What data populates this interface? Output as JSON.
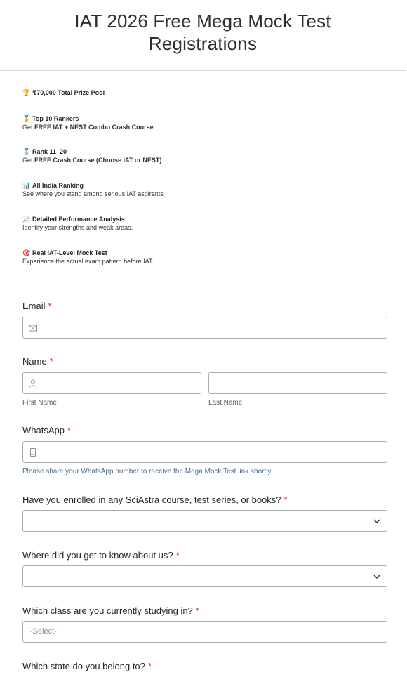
{
  "page": {
    "title": "IAT 2026 Free Mega Mock Test Registrations"
  },
  "features": [
    {
      "icon": "trophy-icon",
      "emoji": "🏆",
      "title": "₹70,000 Total Prize Pool",
      "desc_prefix": "",
      "desc_bold": "",
      "desc_suffix": ""
    },
    {
      "icon": "gold-medal-icon",
      "emoji": "🥇",
      "title": "Top 10 Rankers",
      "desc_prefix": "Get ",
      "desc_bold": "FREE IAT + NEST Combo Crash Course",
      "desc_suffix": ""
    },
    {
      "icon": "silver-medal-icon",
      "emoji": "🥈",
      "title": "Rank 11–20",
      "desc_prefix": "Get ",
      "desc_bold": "FREE Crash Course (Choose IAT or NEST)",
      "desc_suffix": ""
    },
    {
      "icon": "bar-chart-icon",
      "emoji": "📊",
      "title": "All India Ranking",
      "desc_prefix": "See where you stand among serious IAT aspirants.",
      "desc_bold": "",
      "desc_suffix": ""
    },
    {
      "icon": "trend-chart-icon",
      "emoji": "📈",
      "title": "Detailed Performance Analysis",
      "desc_prefix": "Identify your strengths and weak areas.",
      "desc_bold": "",
      "desc_suffix": ""
    },
    {
      "icon": "target-icon",
      "emoji": "🎯",
      "title": "Real IAT-Level Mock Test",
      "desc_prefix": "Experience the actual exam pattern before IAT.",
      "desc_bold": "",
      "desc_suffix": ""
    }
  ],
  "form": {
    "required_mark": "*",
    "email": {
      "label": "Email",
      "value": "",
      "placeholder": ""
    },
    "name": {
      "label": "Name",
      "first_sub": "First Name",
      "last_sub": "Last Name",
      "first_value": "",
      "last_value": ""
    },
    "whatsapp": {
      "label": "WhatsApp",
      "value": "",
      "help": "Please share your WhatsApp number to receive the Mega Mock Test link shortly."
    },
    "enrolled": {
      "label": "Have you enrolled in any SciAstra course, test series, or books?",
      "selected": ""
    },
    "source": {
      "label": "Where did you get to know about us?",
      "selected": ""
    },
    "class": {
      "label": "Which class are you currently studying in?",
      "placeholder": "-Select-"
    },
    "state": {
      "label": "Which state do you belong to?"
    }
  }
}
